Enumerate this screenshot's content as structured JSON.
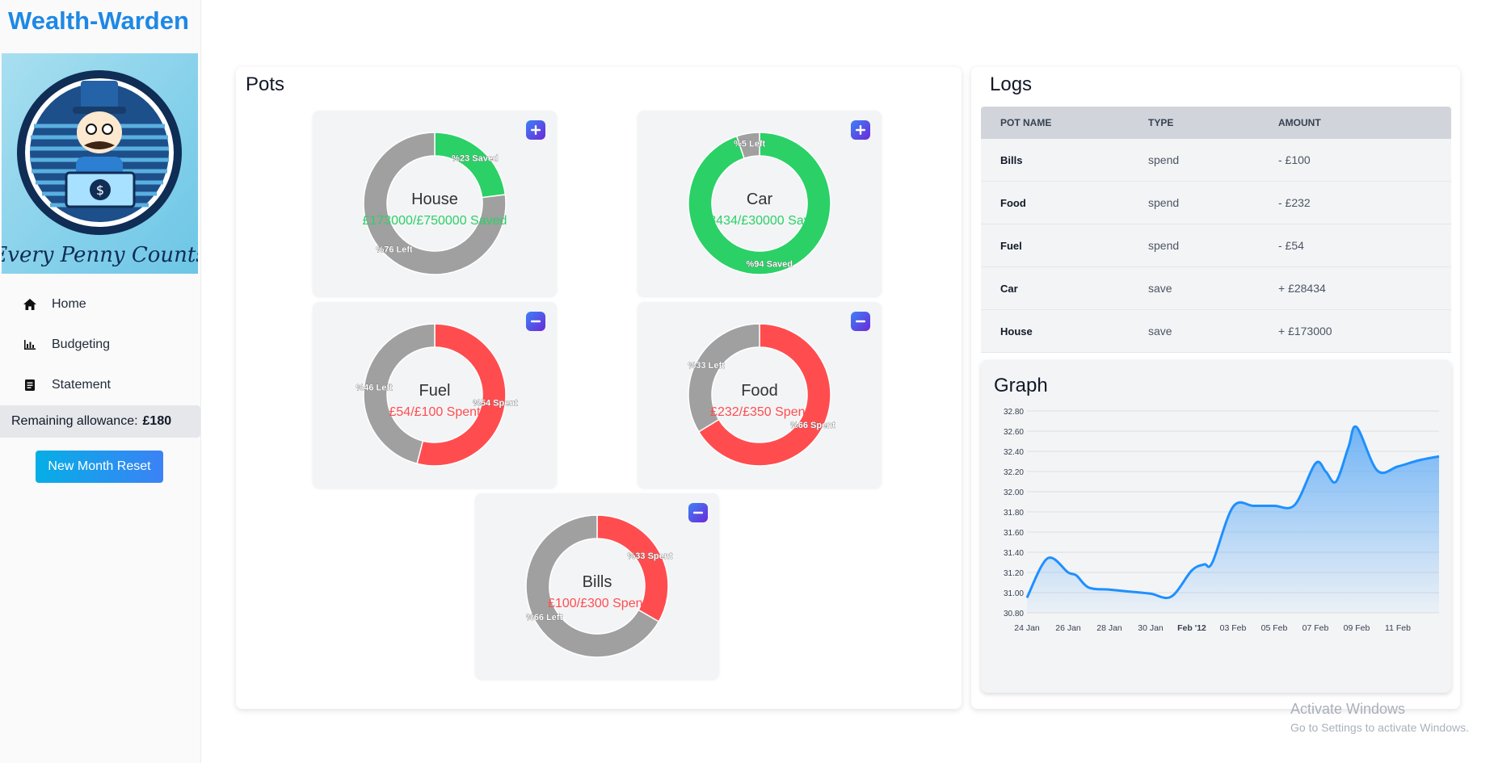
{
  "app": {
    "title": "Wealth-Warden"
  },
  "logo": {
    "caption": "Every Penny Counts",
    "icon": "banker-mascot-logo"
  },
  "sidebar": {
    "items": [
      {
        "label": "Home",
        "icon": "home-icon"
      },
      {
        "label": "Budgeting",
        "icon": "chart-icon"
      },
      {
        "label": "Statement",
        "icon": "document-icon"
      }
    ],
    "allowance_label": "Remaining allowance:",
    "allowance_value": "£180",
    "reset_button": "New Month Reset"
  },
  "pots": {
    "title": "Pots",
    "items": [
      {
        "name": "House",
        "amount_text": "£173000/£750000 Saved",
        "primary_label": "%23 Saved",
        "secondary_label": "%76 Left",
        "kind": "save",
        "fraction": 0.23,
        "button": "plus",
        "button_icon": "plus-icon"
      },
      {
        "name": "Car",
        "amount_text": "£28434/£30000 Saved",
        "primary_label": "%94 Saved",
        "secondary_label": "%5 Left",
        "kind": "save",
        "fraction": 0.948,
        "button": "plus",
        "button_icon": "plus-icon"
      },
      {
        "name": "Fuel",
        "amount_text": "£54/£100 Spent",
        "primary_label": "%54 Spent",
        "secondary_label": "%46 Left",
        "kind": "spend",
        "fraction": 0.54,
        "button": "minus",
        "button_icon": "minus-icon"
      },
      {
        "name": "Food",
        "amount_text": "£232/£350 Spent",
        "primary_label": "%66 Spent",
        "secondary_label": "%33 Left",
        "kind": "spend",
        "fraction": 0.663,
        "button": "minus",
        "button_icon": "minus-icon"
      },
      {
        "name": "Bills",
        "amount_text": "£100/£300 Spent",
        "primary_label": "%33 Spent",
        "secondary_label": "%66 Left",
        "kind": "spend",
        "fraction": 0.333,
        "button": "minus",
        "button_icon": "minus-icon"
      }
    ],
    "colors": {
      "save": "#2bd166",
      "spend": "#ff4d4f",
      "remaining": "#a0a0a0"
    }
  },
  "logs": {
    "title": "Logs",
    "columns": [
      "POT NAME",
      "TYPE",
      "AMOUNT"
    ],
    "rows": [
      {
        "pot": "Bills",
        "type": "spend",
        "amount": "- £100"
      },
      {
        "pot": "Food",
        "type": "spend",
        "amount": "- £232"
      },
      {
        "pot": "Fuel",
        "type": "spend",
        "amount": "- £54"
      },
      {
        "pot": "Car",
        "type": "save",
        "amount": "+ £28434"
      },
      {
        "pot": "House",
        "type": "save",
        "amount": "+ £173000"
      }
    ]
  },
  "graph": {
    "title": "Graph"
  },
  "chart_data": {
    "type": "area",
    "title": "Graph",
    "xlabel": "",
    "ylabel": "",
    "x": [
      "24 Jan",
      "25 Jan",
      "26 Jan",
      "26.5 Jan",
      "27 Jan",
      "28 Jan",
      "29 Jan",
      "30 Jan",
      "31 Jan",
      "1 Feb",
      "1.5 Feb",
      "2 Feb",
      "3 Feb",
      "4 Feb",
      "5 Feb",
      "6 Feb",
      "7 Feb",
      "7.5 Feb",
      "8 Feb",
      "8.5 Feb",
      "9 Feb",
      "10 Feb",
      "11 Feb",
      "12 Feb",
      "13 Feb"
    ],
    "x_day": [
      0,
      1,
      2,
      2.4,
      3,
      4,
      5,
      6,
      7,
      8,
      8.6,
      9,
      10,
      11,
      12,
      13,
      14,
      14.5,
      15,
      15.6,
      16,
      17,
      18,
      19,
      20
    ],
    "values": [
      30.95,
      31.34,
      31.2,
      31.17,
      31.05,
      31.03,
      31.01,
      30.99,
      30.96,
      31.22,
      31.28,
      31.3,
      31.85,
      31.86,
      31.86,
      31.87,
      32.28,
      32.2,
      32.1,
      32.44,
      32.64,
      32.21,
      32.25,
      32.31,
      32.35
    ],
    "series": [
      {
        "values": [
          30.95,
          31.34,
          31.2,
          31.17,
          31.05,
          31.03,
          31.01,
          30.99,
          30.96,
          31.22,
          31.28,
          31.3,
          31.85,
          31.86,
          31.86,
          31.87,
          32.28,
          32.2,
          32.1,
          32.44,
          32.64,
          32.21,
          32.25,
          32.31,
          32.35
        ]
      }
    ],
    "ylim": [
      30.8,
      32.8
    ],
    "yticks": [
      "30.80",
      "31.00",
      "31.20",
      "31.40",
      "31.60",
      "31.80",
      "32.00",
      "32.20",
      "32.40",
      "32.60",
      "32.80"
    ],
    "xticks": [
      {
        "label": "24 Jan",
        "bold": false
      },
      {
        "label": "26 Jan",
        "bold": false
      },
      {
        "label": "28 Jan",
        "bold": false
      },
      {
        "label": "30 Jan",
        "bold": false
      },
      {
        "label": "Feb '12",
        "bold": true
      },
      {
        "label": "03 Feb",
        "bold": false
      },
      {
        "label": "05 Feb",
        "bold": false
      },
      {
        "label": "07 Feb",
        "bold": false
      },
      {
        "label": "09 Feb",
        "bold": false
      },
      {
        "label": "11 Feb",
        "bold": false
      }
    ],
    "grid": true,
    "line_color": "#1e90ff",
    "fill_color": "#5aa9f5"
  },
  "watermark": {
    "title": "Activate Windows",
    "subtitle": "Go to Settings to activate Windows."
  }
}
